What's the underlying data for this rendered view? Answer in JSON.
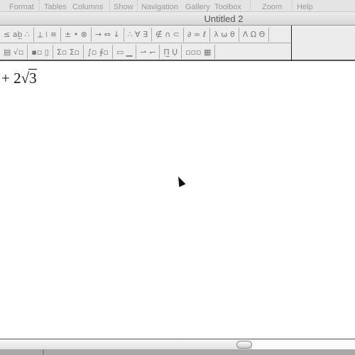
{
  "menu": [
    "Format",
    "Tables",
    "Columns",
    "Show",
    "Navigation",
    "Gallery",
    "Toolbox",
    "Zoom",
    "Help"
  ],
  "window": {
    "title": "Untitled 2"
  },
  "toolbar": {
    "row1": [
      "≤ ab̲ ∴",
      "⟂ ⁞ ≡",
      "± • ⊗",
      "→ ⇔ ↓",
      "∴ ∀ ∃",
      "∉ ∩ ⊂",
      "∂ ∞ ℓ",
      "λ ω θ",
      "Λ Ω Θ"
    ],
    "row2": [
      "▤ √▫",
      "▪▫ ▯",
      "Σ▫ Σ▫",
      "∫▫ ∮▫",
      "▭ ▁",
      "⇀ ↽",
      "Π̲ Ụ",
      "▫▫▫ ▦"
    ]
  },
  "equation": {
    "before_root": "+ 2",
    "radicand": "3"
  },
  "scrollbar": {
    "horizontal_position_percent": 68
  }
}
